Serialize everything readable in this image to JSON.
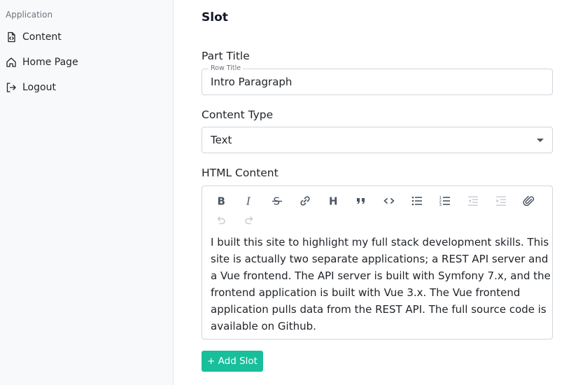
{
  "sidebar": {
    "heading": "Application",
    "items": [
      {
        "label": "Content",
        "icon": "file-code-icon"
      },
      {
        "label": "Home Page",
        "icon": "home-icon"
      },
      {
        "label": "Logout",
        "icon": "logout-icon"
      }
    ]
  },
  "main": {
    "title": "Slot",
    "part_title": {
      "label": "Part Title",
      "floating_label": "Row Title",
      "value": "Intro Paragraph"
    },
    "content_type": {
      "label": "Content Type",
      "value": "Text"
    },
    "html_content": {
      "label": "HTML Content",
      "toolbar": [
        "bold-icon",
        "italic-icon",
        "strikethrough-icon",
        "link-icon",
        "heading-icon",
        "quote-icon",
        "code-icon",
        "bullet-list-icon",
        "numbered-list-icon",
        "outdent-icon",
        "indent-icon",
        "attach-icon",
        "undo-icon",
        "redo-icon"
      ],
      "body": "I built this site to highlight my full stack development skills. This site is actually two separate applications; a REST API server and a Vue frontend. The API server is built with Symfony 7.x, and the frontend application is built with Vue 3.x. The Vue frontend application pulls data from the REST API. The full source code is available on Github."
    },
    "add_slot_label": "+ Add Slot"
  },
  "colors": {
    "accent": "#19be9b",
    "sidebar_bg": "#f8f9fa",
    "border": "#d1d5db"
  }
}
